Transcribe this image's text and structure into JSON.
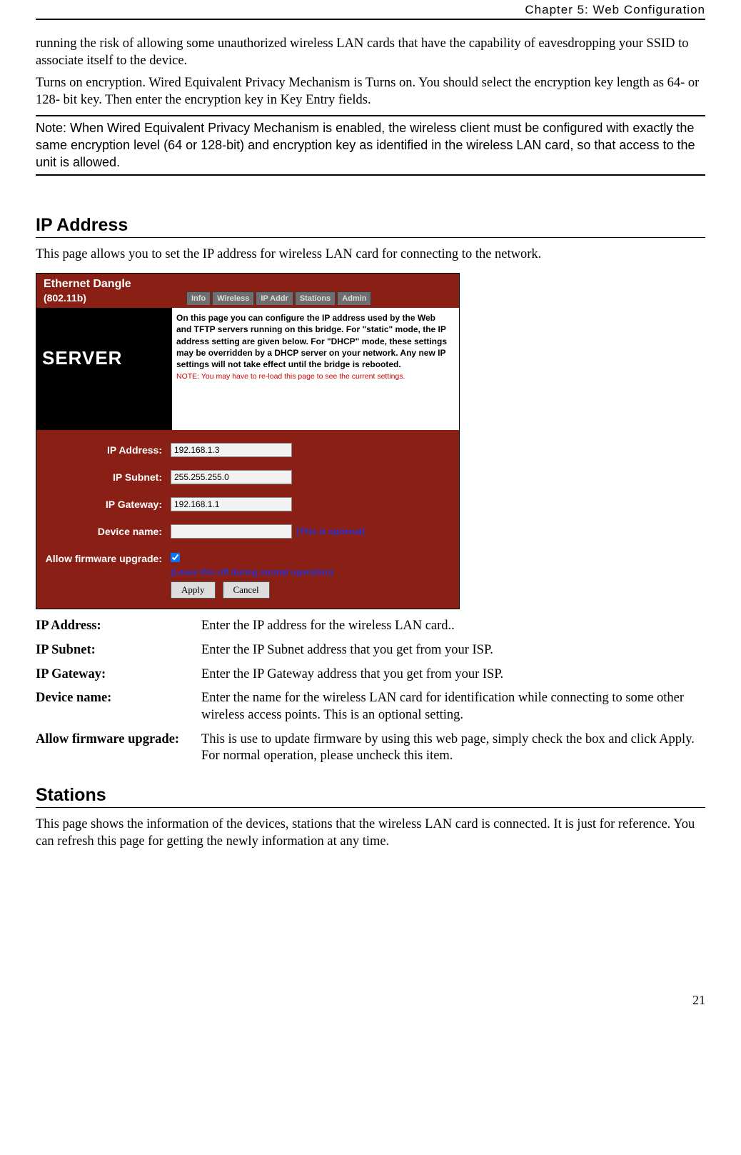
{
  "header": {
    "chapter": "Chapter 5: Web Configuration"
  },
  "intro": {
    "p1": "running the risk of allowing some unauthorized wireless LAN cards that have the capability of eavesdropping your SSID to associate itself to the device.",
    "p2": "Turns on encryption. Wired Equivalent Privacy Mechanism is Turns on. You should select the encryption key length as 64- or 128- bit key. Then enter the encryption key in Key Entry fields.",
    "note": "Note: When Wired Equivalent Privacy Mechanism is enabled, the wireless client must be configured with exactly the same encryption level (64 or 128-bit) and encryption key as identified in the wireless LAN card, so that access to the unit is allowed."
  },
  "ip_section": {
    "title": "IP Address",
    "desc": "This page allows you to set the IP address for wireless LAN card for connecting to the network."
  },
  "screenshot": {
    "brand_title": "Ethernet Dangle",
    "brand_sub": "(802.11b)",
    "tabs": {
      "t0": "Info",
      "t1": "Wireless",
      "t2": "IP Addr",
      "t3": "Stations",
      "t4": "Admin"
    },
    "sidebar": "SERVER",
    "desc_text": "On this page you can configure the IP address used by the Web and TFTP servers running on this bridge. For \"static\" mode, the IP address setting are given below. For \"DHCP\" mode, these settings may be overridden by a DHCP server on your network. Any new IP settings will not take effect until the bridge is rebooted.",
    "desc_note": "NOTE: You may have to re-load this page to see the current settings.",
    "labels": {
      "ip_addr": "IP Address:",
      "ip_subnet": "IP Subnet:",
      "ip_gateway": "IP Gateway:",
      "device_name": "Device name:",
      "allow_fw": "Allow firmware upgrade:"
    },
    "values": {
      "ip_addr": "192.168.1.3",
      "ip_subnet": "255.255.255.0",
      "ip_gateway": "192.168.1.1",
      "device_name": ""
    },
    "hints": {
      "device_name": "(This is optional)",
      "allow_fw": "(Leave this off during normal operation)"
    },
    "buttons": {
      "apply": "Apply",
      "cancel": "Cancel"
    }
  },
  "defs": {
    "r0": {
      "term": "IP Address:",
      "desc": "Enter the IP address for the wireless LAN card.."
    },
    "r1": {
      "term": "IP Subnet:",
      "desc": "Enter the IP Subnet address that you get from your ISP."
    },
    "r2": {
      "term": "IP Gateway:",
      "desc": "Enter the IP Gateway address that you get from your ISP."
    },
    "r3": {
      "term": "Device name:",
      "desc": "Enter the name for the wireless LAN card for identification while connecting to some other wireless access points. This is an optional setting."
    },
    "r4": {
      "term": "Allow firmware upgrade:",
      "desc": "This is use to update firmware by using this web page, simply check the box and click Apply. For normal operation, please uncheck this item."
    }
  },
  "stations_section": {
    "title": "Stations",
    "desc": "This page shows the information of the devices, stations that the wireless LAN card is connected. It is just for reference. You can refresh this page for getting the newly information at any time."
  },
  "page_number": "21"
}
